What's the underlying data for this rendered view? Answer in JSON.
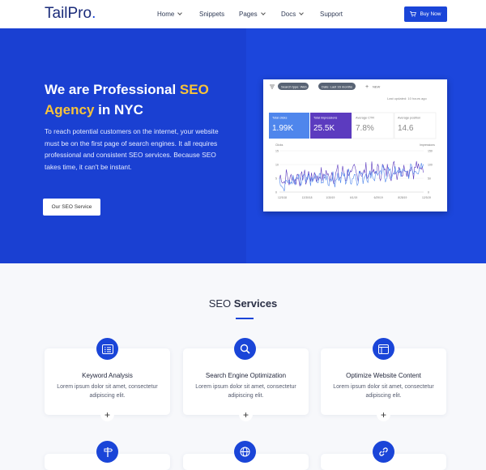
{
  "brand": {
    "name": "TailPro",
    "dot": "."
  },
  "nav": {
    "items": [
      {
        "label": "Home",
        "dropdown": true
      },
      {
        "label": "Snippets",
        "dropdown": false
      },
      {
        "label": "Pages",
        "dropdown": true
      },
      {
        "label": "Docs",
        "dropdown": true
      },
      {
        "label": "Support",
        "dropdown": false
      }
    ],
    "buy_label": "Buy Now"
  },
  "hero": {
    "title_1": "We are Professional ",
    "title_hl1": "SEO",
    "title_hl2": "Agency",
    "title_2": " in NYC",
    "body": "To reach potential customers on the internet, your website must be on the first page of search engines. It all requires professional and consistent SEO services. Because SEO takes time, it can't be instant.",
    "cta": "Our SEO Service"
  },
  "console": {
    "chips": [
      "Search type: Web",
      "Date: Last 16 months"
    ],
    "new_label": "NEW",
    "last_updated": "Last updated: 10 hours ago",
    "metrics": [
      {
        "label": "Total clicks",
        "value": "1.99K",
        "bg": "#4f86ec"
      },
      {
        "label": "Total impressions",
        "value": "25.5K",
        "bg": "#5c3bbf"
      },
      {
        "label": "Average CTR",
        "value": "7.8%",
        "bg": "#ffffff"
      },
      {
        "label": "Average position",
        "value": "14.6",
        "bg": "#ffffff"
      }
    ],
    "left_axis_title": "Clicks",
    "right_axis_title": "Impressions",
    "left_ticks": [
      "15",
      "10",
      "5",
      "0"
    ],
    "right_ticks": [
      "150",
      "100",
      "50",
      "0"
    ],
    "dates": [
      "12/3/18",
      "12/30/18",
      "1/30/19",
      "6/1/19",
      "6/29/19",
      "8/28/19",
      "12/3/19"
    ]
  },
  "services": {
    "title_plain": "SEO ",
    "title_bold": "Services",
    "cards": [
      {
        "title": "Keyword Analysis",
        "text": "Lorem ipsum dolor sit amet, consectetur adipiscing elit.",
        "icon": "list-icon"
      },
      {
        "title": "Search Engine Optimization",
        "text": "Lorem ipsum dolor sit amet, consectetur adipiscing elit.",
        "icon": "search-icon"
      },
      {
        "title": "Optimize Website Content",
        "text": "Lorem ipsum dolor sit amet, consectetur adipiscing elit.",
        "icon": "layout-icon"
      }
    ],
    "row2_icons": [
      "signpost-icon",
      "globe-icon",
      "link-icon"
    ]
  },
  "colors": {
    "primary": "#1a45d8",
    "accent": "#f8c33a",
    "clicks": "#4f86ec",
    "impressions": "#5c3bbf"
  }
}
